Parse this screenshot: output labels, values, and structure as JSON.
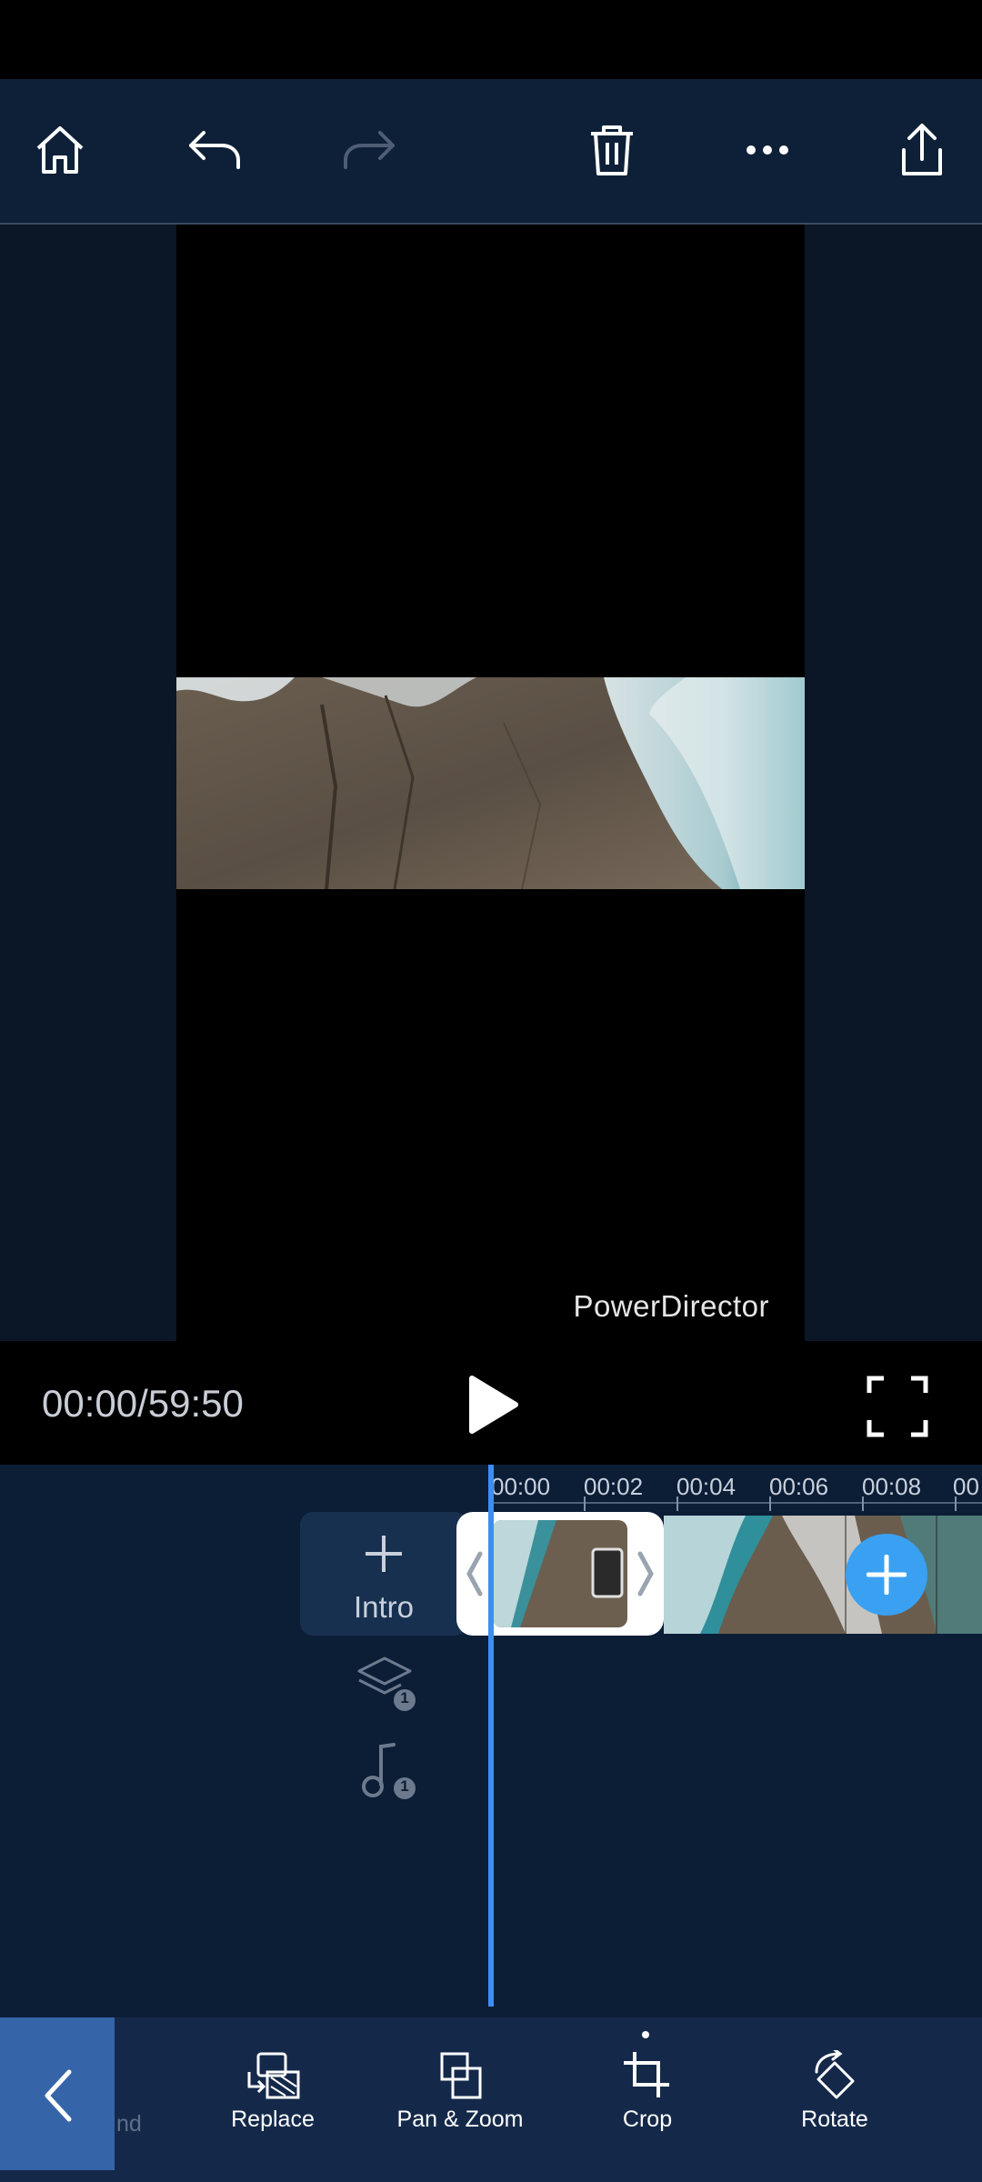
{
  "toolbar": {
    "home_icon": "home-icon",
    "undo_icon": "undo-icon",
    "redo_icon": "redo-icon",
    "delete_icon": "trash-icon",
    "more_icon": "more-icon",
    "share_icon": "share-icon"
  },
  "preview": {
    "watermark": "PowerDirector"
  },
  "playback": {
    "timecode": "00:00/59:50"
  },
  "timeline": {
    "ticks": [
      "00:00",
      "00:02",
      "00:04",
      "00:06",
      "00:08",
      "00"
    ],
    "intro_label": "Intro",
    "overlay_count": "1",
    "audio_count": "1"
  },
  "bottom_toolbar": {
    "partial_label": "nd",
    "tools": [
      {
        "label": "Replace",
        "icon": "replace-icon"
      },
      {
        "label": "Pan & Zoom",
        "icon": "pan-zoom-icon"
      },
      {
        "label": "Crop",
        "icon": "crop-icon"
      },
      {
        "label": "Rotate",
        "icon": "rotate-icon"
      }
    ]
  },
  "colors": {
    "accent": "#3d8ef0",
    "add_button": "#3aa0f2",
    "toolbar_bg": "#0d2038",
    "timeline_bg": "#0c1d36"
  }
}
